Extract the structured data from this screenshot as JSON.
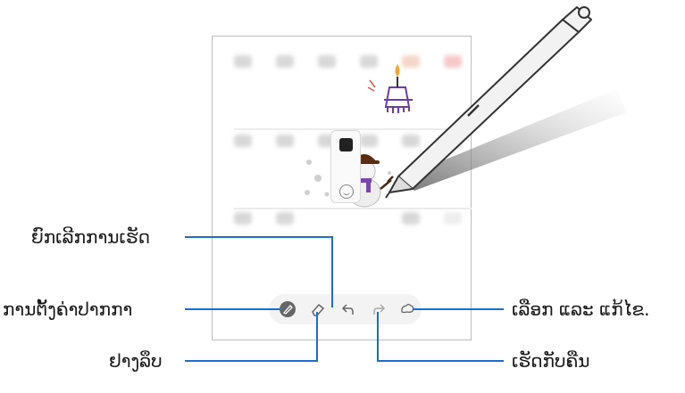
{
  "labels": {
    "undo": "ຍົກເລີກການເຮັດ",
    "pen_settings": "ການຕັ້ງຄ່າປາກກາ",
    "eraser": "ຢາງລຶບ",
    "select_edit": "ເລືອກ ແລະ ແກ້ໄຂ.",
    "redo": "ເຮັດກັບຄືນ"
  },
  "toolbar": {
    "tools": [
      "pen-icon",
      "eraser-icon",
      "undo-icon",
      "redo-icon",
      "lasso-select-icon"
    ]
  },
  "colors": {
    "callout_line": "#1a6dd1",
    "pen_body": "#f2f2f2",
    "snowman_hat": "#5a2d12",
    "crown_drawing": "#6d3aa8"
  }
}
